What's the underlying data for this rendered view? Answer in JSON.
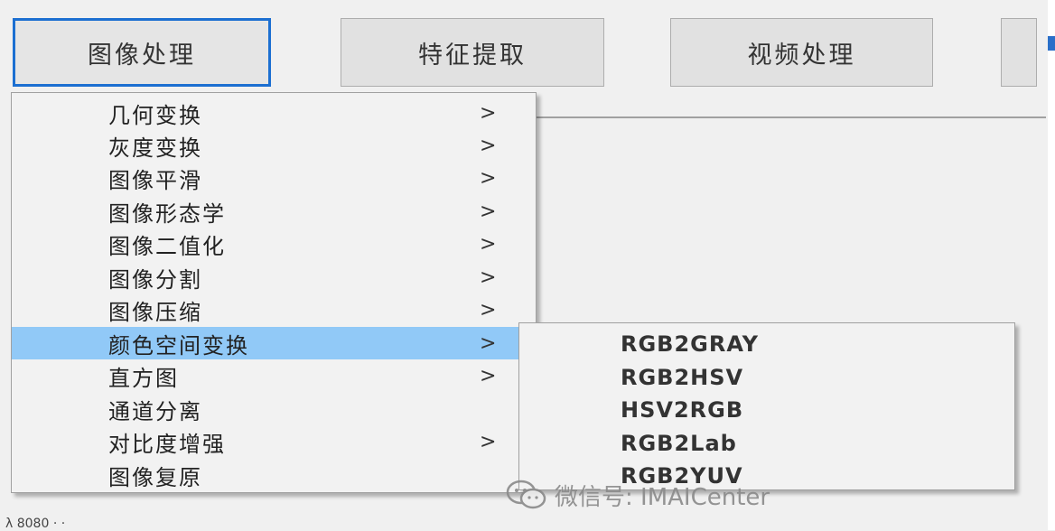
{
  "toolbar": {
    "buttons": [
      {
        "label": "图像处理",
        "active": true
      },
      {
        "label": "特征提取",
        "active": false
      },
      {
        "label": "视频处理",
        "active": false
      }
    ]
  },
  "main_menu": {
    "items": [
      {
        "label": "几何变换",
        "arrow": ">"
      },
      {
        "label": "灰度变换",
        "arrow": ">"
      },
      {
        "label": "图像平滑",
        "arrow": ">"
      },
      {
        "label": "图像形态学",
        "arrow": ">"
      },
      {
        "label": "图像二值化",
        "arrow": ">"
      },
      {
        "label": "图像分割",
        "arrow": ">"
      },
      {
        "label": "图像压缩",
        "arrow": ">"
      },
      {
        "label": "颜色空间变换",
        "arrow": ">",
        "highlighted": true
      },
      {
        "label": "直方图",
        "arrow": ">"
      },
      {
        "label": "通道分离",
        "arrow": ""
      },
      {
        "label": "对比度增强",
        "arrow": ">"
      },
      {
        "label": "图像复原",
        "arrow": ""
      }
    ]
  },
  "submenu": {
    "items": [
      {
        "label": "RGB2GRAY"
      },
      {
        "label": "RGB2HSV"
      },
      {
        "label": "HSV2RGB"
      },
      {
        "label": "RGB2Lab"
      },
      {
        "label": "RGB2YUV"
      }
    ]
  },
  "watermark": {
    "text": "微信号: IMAICenter",
    "icon": "wechat-icon"
  },
  "footer": {
    "text": "λ 8080 · ·"
  },
  "colors": {
    "active_border": "#1c6fd1",
    "hover": "#91c9f7",
    "menu_bg": "#f2f2f2"
  }
}
